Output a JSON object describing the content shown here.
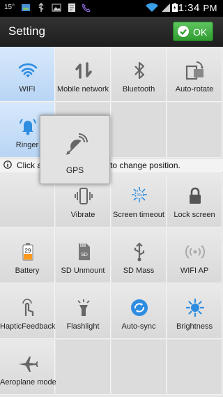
{
  "status": {
    "temperature": "15°",
    "time": "11:34",
    "ampm": "PM"
  },
  "header": {
    "title": "Setting",
    "ok_label": "OK"
  },
  "hint": {
    "text": "Click and toggle the icon to change position."
  },
  "dragging": {
    "label": "GPS",
    "icon": "gps-icon"
  },
  "tiles": [
    {
      "label": "WIFI",
      "icon": "wifi-icon",
      "on": true
    },
    {
      "label": "Mobile network",
      "icon": "mobile-network-icon",
      "on": false
    },
    {
      "label": "Bluetooth",
      "icon": "bluetooth-icon",
      "on": false
    },
    {
      "label": "Auto-rotate",
      "icon": "auto-rotate-icon",
      "on": false
    },
    {
      "label": "Ringer",
      "icon": "ringer-icon",
      "on": true
    },
    {
      "label": "Vibrate",
      "icon": "vibrate-icon",
      "on": false
    },
    {
      "label": "Screen timeout",
      "icon": "screen-timeout-icon",
      "on": false
    },
    {
      "label": "Lock screen",
      "icon": "lock-icon",
      "on": false
    },
    {
      "label": "Battery",
      "icon": "battery-icon",
      "on": false,
      "value": "29"
    },
    {
      "label": "SD Unmount",
      "icon": "sd-card-icon",
      "on": false
    },
    {
      "label": "SD Mass",
      "icon": "usb-icon",
      "on": false
    },
    {
      "label": "WIFI AP",
      "icon": "wifi-ap-icon",
      "on": false
    },
    {
      "label": "HapticFeedback",
      "icon": "haptic-icon",
      "on": false
    },
    {
      "label": "Flashlight",
      "icon": "flashlight-icon",
      "on": false
    },
    {
      "label": "Auto-sync",
      "icon": "sync-icon",
      "on": false
    },
    {
      "label": "Brightness",
      "icon": "brightness-icon",
      "on": false
    },
    {
      "label": "Aeroplane mode",
      "icon": "airplane-icon",
      "on": false
    }
  ],
  "colors": {
    "active_tile": "#c6def8",
    "ok_green": "#3aa93a",
    "icon_blue": "#2f8de0",
    "icon_gray": "#666666"
  }
}
